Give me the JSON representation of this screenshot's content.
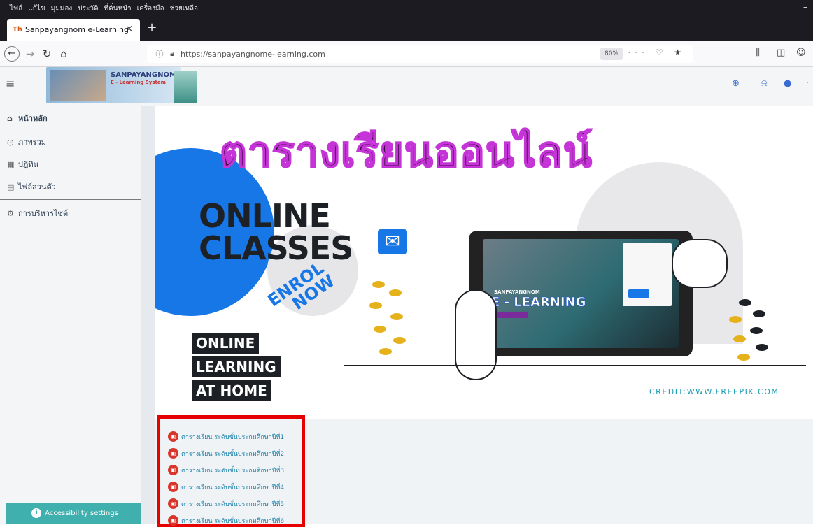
{
  "browser": {
    "menu": [
      "ไฟล์",
      "แก้ไข",
      "มุมมอง",
      "ประวัติ",
      "ที่คั่นหน้า",
      "เครื่องมือ",
      "ช่วยเหลือ"
    ],
    "minimize": "–",
    "tab_title": "Sanpayangnom e-Learning",
    "tab_favicon": "Th",
    "tab_close": "×",
    "new_tab": "+",
    "url": "https://sanpayangnome-learning.com",
    "zoom": "80%",
    "url_actions": "··· ♡ ★",
    "accent": "#0060df"
  },
  "site": {
    "logo_title": "SANPAYANGNOM",
    "logo_subtitle": "E - Learning System"
  },
  "sidebar": {
    "items": [
      {
        "icon": "home-icon",
        "label": "หน้าหลัก"
      },
      {
        "icon": "calendar-icon",
        "label": "ภาพรวม"
      },
      {
        "icon": "grid-icon",
        "label": "ปฏิทิน"
      },
      {
        "icon": "file-icon",
        "label": "ไฟล์ส่วนตัว"
      },
      {
        "icon": "globe-icon",
        "label": "การบริหารไซต์"
      }
    ],
    "accessibility": "Accessibility settings"
  },
  "banner": {
    "thai_title": "ตารางเรียนออนไลน์",
    "online": "ONLINE",
    "classes": "CLASSES",
    "enrol": "ENROL",
    "now": "NOW",
    "ol_line1": "ONLINE",
    "ol_line2": "LEARNING",
    "ol_line3": "AT HOME",
    "tablet_brand": "SANPAYANGNOM",
    "tablet_title": "E - LEARNING",
    "credit": "CREDIT:WWW.FREEPIK.COM"
  },
  "links": [
    "ตารางเรียน ระดับชั้นประถมศึกษาปีที่1",
    "ตารางเรียน ระดับชั้นประถมศึกษาปีที่2",
    "ตารางเรียน ระดับชั้นประถมศึกษาปีที่3",
    "ตารางเรียน ระดับชั้นประถมศึกษาปีที่4",
    "ตารางเรียน ระดับชั้นประถมศึกษาปีที่5",
    "ตารางเรียน ระดับชั้นประถมศึกษาปีที่6"
  ]
}
